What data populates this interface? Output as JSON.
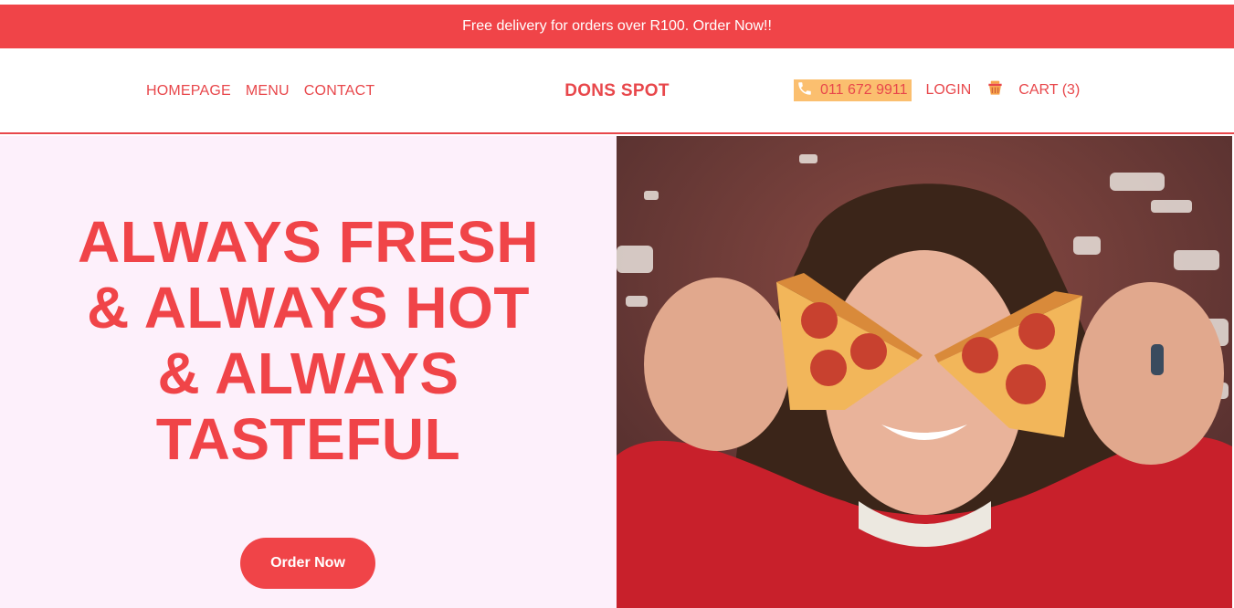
{
  "banner": {
    "text": "Free delivery for orders over R100. Order Now!!"
  },
  "nav": {
    "links": [
      "HOMEPAGE",
      "MENU",
      "CONTACT"
    ],
    "brand": "DONS SPOT",
    "phone": "011 672 9911",
    "login": "LOGIN",
    "cart": "CART (3)"
  },
  "hero": {
    "headline_lines": [
      "ALWAYS FRESH",
      "& ALWAYS HOT",
      "& ALWAYS",
      "TASTEFUL"
    ],
    "cta": "Order Now"
  },
  "icons": {
    "phone": "phone-icon",
    "cart": "basket-icon"
  },
  "colors": {
    "accent": "#f04448",
    "phone_bg": "#fbbf6f",
    "hero_bg": "#fdf0fb"
  }
}
